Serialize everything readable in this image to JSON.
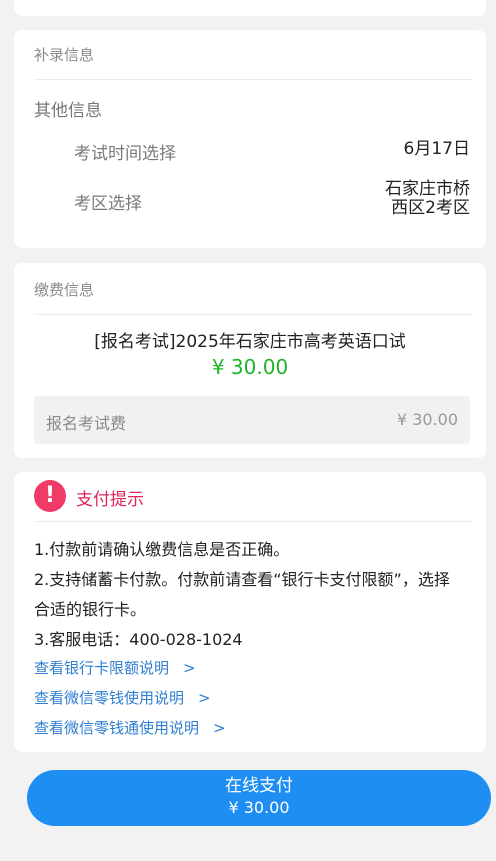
{
  "supplement": {
    "title": "补录信息",
    "subtitle": "其他信息",
    "rows": [
      {
        "label": "考试时间选择",
        "value": "6月17日"
      },
      {
        "label": "考区选择",
        "value_line1": "石家庄市桥",
        "value_line2": "西区2考区"
      }
    ]
  },
  "payment": {
    "title": "缴费信息",
    "exam_name": "[报名考试]2025年石家庄市高考英语口试",
    "exam_price": "¥ 30.00",
    "fee_label": "报名考试费",
    "fee_value": "¥ 30.00"
  },
  "tips": {
    "icon_text": "!",
    "title": "支付提示",
    "line1": "1.付款前请确认缴费信息是否正确。",
    "line2a": "2.支持储蓄卡付款。付款前请查看“银行卡支付限额”，选择",
    "line2b": "合适的银行卡。",
    "line3": "3.客服电话：400-028-1024",
    "links": [
      "查看银行卡限额说明",
      "查看微信零钱使用说明",
      "查看微信零钱通使用说明"
    ],
    "chevron": ">"
  },
  "pay_button": {
    "label": "在线支付",
    "amount": "¥ 30.00"
  },
  "colors": {
    "accent": "#1e8ef2",
    "price_green": "#1fb52b",
    "warning_pink": "#f03a67",
    "link_blue": "#2f7fd1"
  },
  "icons": {
    "warning": "warning-icon",
    "chevron": "chevron-right-icon"
  }
}
